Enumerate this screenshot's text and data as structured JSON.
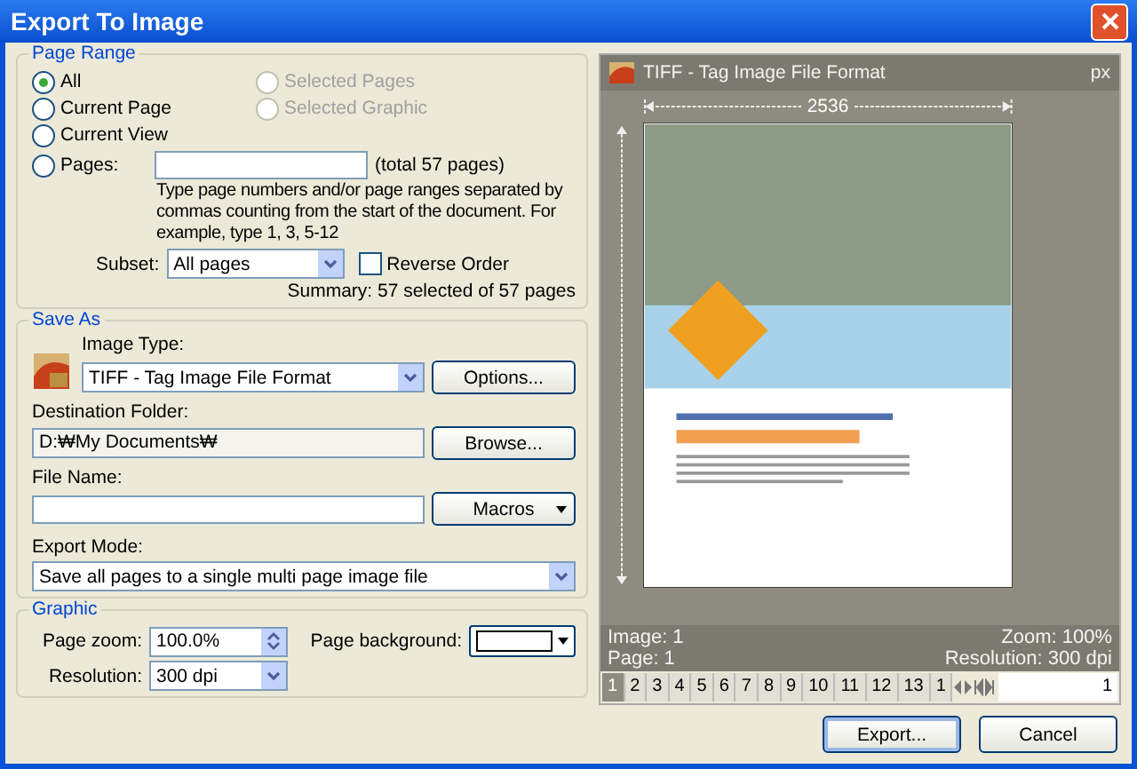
{
  "window": {
    "title": "Export To Image"
  },
  "page_range": {
    "title": "Page Range",
    "options": [
      {
        "label": "All",
        "selected": true,
        "disabled": false
      },
      {
        "label": "Selected Pages",
        "selected": false,
        "disabled": true
      },
      {
        "label": "Current Page",
        "selected": false,
        "disabled": false
      },
      {
        "label": "Selected Graphic",
        "selected": false,
        "disabled": true
      },
      {
        "label": "Current View",
        "selected": false,
        "disabled": false
      }
    ],
    "pages_option": {
      "label": "Pages:",
      "selected": false
    },
    "total": "(total 57 pages)",
    "help": "Type page numbers and/or page ranges separated by commas counting from the start of the document. For example, type 1, 3, 5-12",
    "subset_label": "Subset:",
    "subset_value": "All pages",
    "reverse_order": {
      "label": "Reverse Order",
      "checked": false
    },
    "summary": "Summary: 57 selected of 57 pages"
  },
  "save_as": {
    "title": "Save As",
    "image_type_label": "Image Type:",
    "image_type_value": "TIFF - Tag Image File Format",
    "options_button": "Options...",
    "destination_label": "Destination Folder:",
    "destination_value": "D:₩My Documents₩",
    "browse_button": "Browse...",
    "file_name_label": "File Name:",
    "macros_button": "Macros",
    "export_mode_label": "Export Mode:",
    "export_mode_value": "Save all pages to a single multi page image file"
  },
  "graphic": {
    "title": "Graphic",
    "page_zoom_label": "Page zoom:",
    "page_zoom_value": "100.0%",
    "resolution_label": "Resolution:",
    "resolution_value": "300 dpi",
    "page_background_label": "Page background:"
  },
  "preview": {
    "title": "TIFF - Tag Image File Format",
    "unit": "px",
    "width_dim": "2536",
    "image_info": "Image: 1",
    "page_info": "Page: 1",
    "zoom_info": "Zoom: 100%",
    "resolution_info": "Resolution: 300 dpi",
    "pages": [
      {
        "label": "1",
        "selected": true
      },
      {
        "label": "2",
        "selected": false
      },
      {
        "label": "3",
        "selected": false
      },
      {
        "label": "4",
        "selected": false
      },
      {
        "label": "5",
        "selected": false
      },
      {
        "label": "6",
        "selected": false
      },
      {
        "label": "7",
        "selected": false
      },
      {
        "label": "8",
        "selected": false
      },
      {
        "label": "9",
        "selected": false
      },
      {
        "label": "10",
        "selected": false
      },
      {
        "label": "11",
        "selected": false
      },
      {
        "label": "12",
        "selected": false
      },
      {
        "label": "13",
        "selected": false
      },
      {
        "label": "1",
        "selected": false
      }
    ],
    "page_input": "1"
  },
  "buttons": [
    {
      "label": "Export..."
    },
    {
      "label": "Cancel"
    }
  ]
}
